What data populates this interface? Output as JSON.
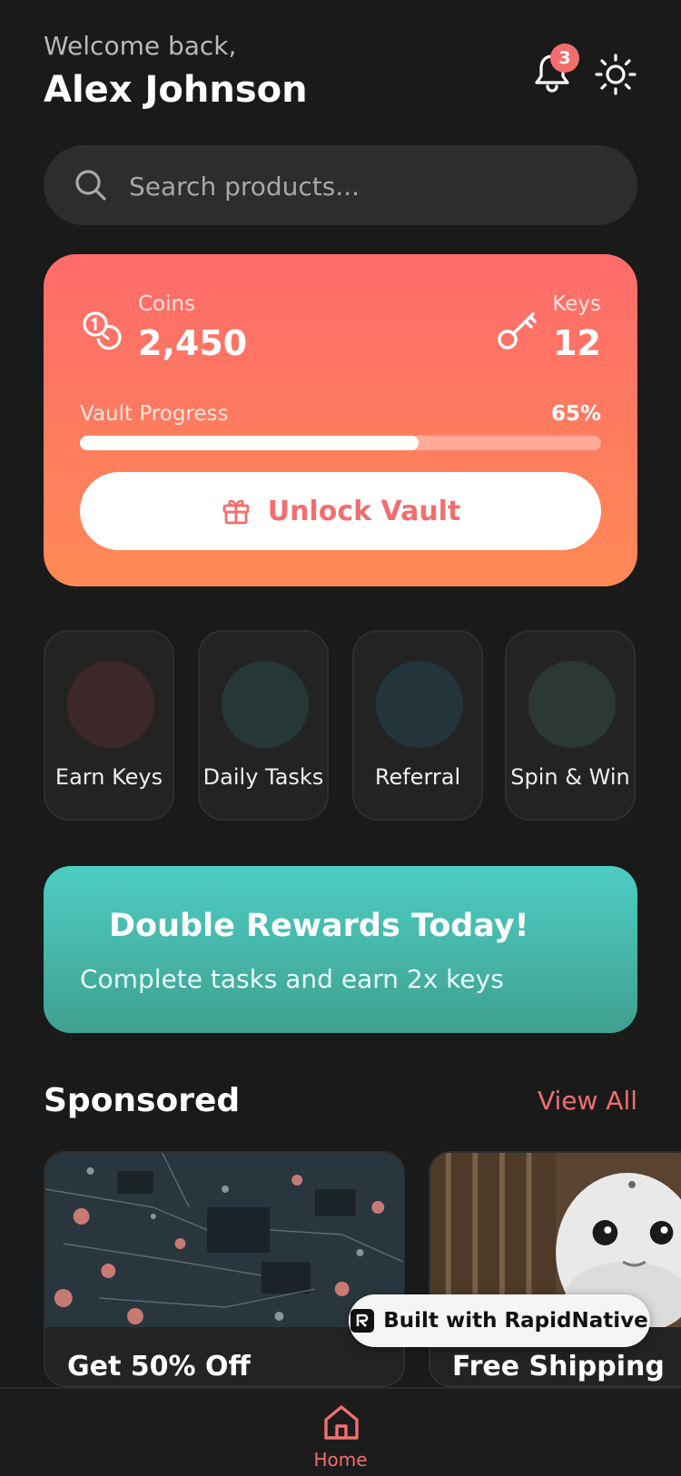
{
  "header": {
    "welcome_text": "Welcome back,",
    "user_name": "Alex Johnson",
    "notification_count": "3",
    "icons": [
      "bell-icon",
      "sun-icon"
    ]
  },
  "search": {
    "placeholder": "Search products...",
    "value": ""
  },
  "vault": {
    "coins_label": "Coins",
    "coins_value": "2,450",
    "keys_label": "Keys",
    "keys_value": "12",
    "progress_label": "Vault Progress",
    "progress_text": "65%",
    "progress_fraction": 0.65,
    "unlock_label": "Unlock Vault",
    "gradient_colors": [
      "#ff6b6b",
      "#ff8a55"
    ]
  },
  "quick_actions": [
    {
      "label": "Earn Keys",
      "color": "#3d2829"
    },
    {
      "label": "Daily Tasks",
      "color": "#253837"
    },
    {
      "label": "Referral",
      "color": "#23353b"
    },
    {
      "label": "Spin & Win",
      "color": "#2c3833"
    }
  ],
  "promo": {
    "title": "Double Rewards Today!",
    "subtitle": "Complete tasks and earn 2x keys",
    "gradient_colors": [
      "#4ecdc4",
      "#3fa08f"
    ]
  },
  "sponsored": {
    "title": "Sponsored",
    "view_all_label": "View All",
    "cards": [
      {
        "title": "Get 50% Off",
        "image": "circuit-board-image"
      },
      {
        "title": "Free Shipping",
        "image": "robot-image"
      }
    ]
  },
  "built_with": {
    "label": "Built with RapidNative"
  },
  "bottom_nav": {
    "items": [
      {
        "label": "Home",
        "icon": "home-icon",
        "active": true
      }
    ]
  },
  "colors": {
    "background": "#1a1a1a",
    "accent": "#f26e6e",
    "surface": "#2d2d2d"
  }
}
